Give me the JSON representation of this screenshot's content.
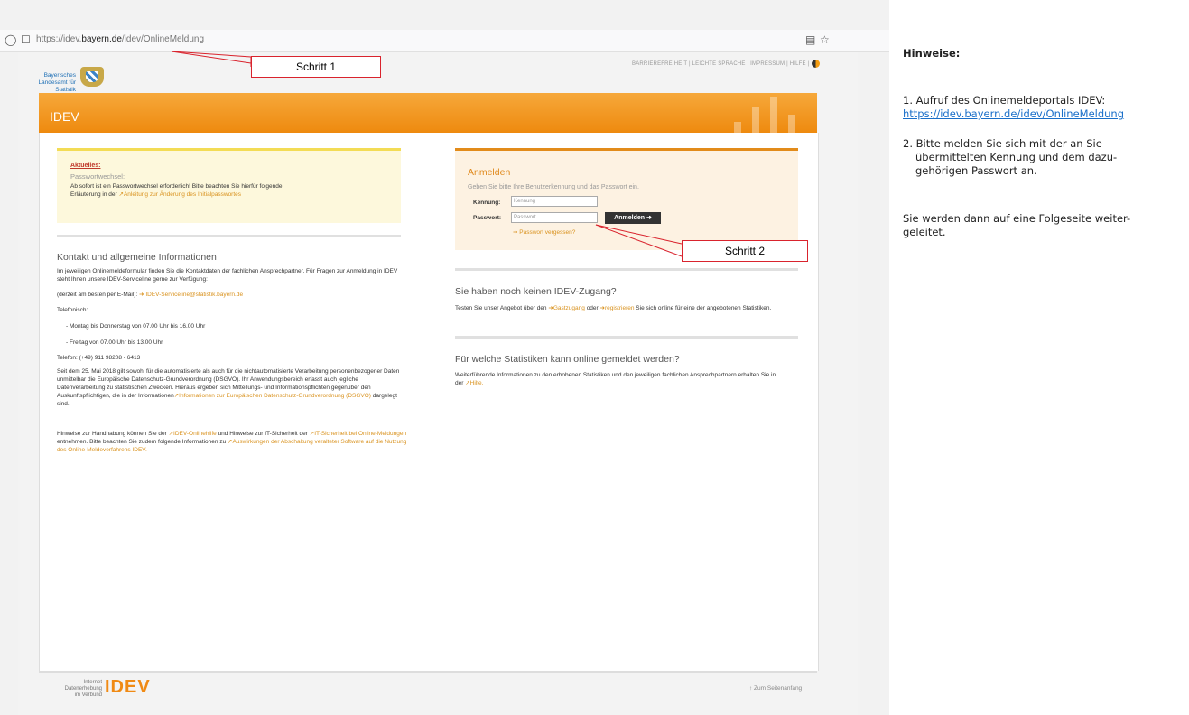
{
  "browser": {
    "url_prefix": "https://idev.",
    "url_host": "bayern.de",
    "url_path": "/idev/OnlineMeldung"
  },
  "site": {
    "logo_line1": "Bayerisches Landesamt für",
    "logo_line2": "Statistik",
    "toplinks": "BARRIEREFREIHEIT | LEICHTE SPRACHE | IMPRESSUM | HILFE |",
    "header_title": "IDEV"
  },
  "aktuelles": {
    "title": "Aktuelles:",
    "subtitle": "Passwortwechsel:",
    "text": "Ab sofort ist ein Passwortwechsel erforderlich! Bitte beachten Sie hierfür folgende",
    "text2": "Erläuterung in der",
    "link": "Anleitung zur Änderung des Initialpasswortes"
  },
  "kontakt": {
    "title": "Kontakt und allgemeine Informationen",
    "p1": "Im jeweiligen Onlinemeldeformular finden Sie die Kontaktdaten der fachlichen Ansprechpartner. Für Fragen zur Anmeldung in IDEV steht Ihnen unsere IDEV-Serviceline gerne zur Verfügung:",
    "email_prefix": "(derzeit am besten per E-Mail):",
    "email": "IDEV-Serviceline@statistik.bayern.de",
    "tel_label": "Telefonisch:",
    "hours1": "- Montag bis Donnerstag von 07.00 Uhr bis 16.00 Uhr",
    "hours2": "- Freitag von 07.00 Uhr bis 13.00 Uhr",
    "phone": "Telefon:  (+49) 911 98208 - 6413",
    "p2": "Seit dem 25. Mai 2018 gilt sowohl für die automatisierte als auch für die nichtautomatisierte Verarbeitung personenbezogener Daten unmittelbar die Europäische Datenschutz-Grundverordnung (DSGVO). Ihr Anwendungsbereich erfasst auch jegliche Datenverarbeitung zu statistischen Zwecken. Hieraus ergeben sich Mitteilungs- und Informationspflichten gegenüber den Auskunftspflichtigen, die in der Informationen",
    "p2_link": "Informationen zur Europäischen Datenschutz-Grundverordnung (DSGVO)",
    "p2_end": "dargelegt sind.",
    "p3a": "Hinweise zur Handhabung können Sie der",
    "p3_link1": "IDEV-Onlinehilfe",
    "p3b": "und Hinweise zur IT-Sicherheit der",
    "p3_link2": "IT-Sicherheit bei Online-Meldungen",
    "p3c": "entnehmen. Bitte beachten Sie zudem folgende Informationen zu",
    "p3_link3": "Auswirkungen der Abschaltung veralteter Software auf die Nutzung des Online-Meldeverfahrens IDEV."
  },
  "login": {
    "title": "Anmelden",
    "hint": "Geben Sie bitte Ihre Benutzerkennung und das Passwort ein.",
    "user_label": "Kennung:",
    "user_placeholder": "Kennung",
    "pass_label": "Passwort:",
    "pass_placeholder": "Passwort",
    "button": "Anmelden ➜",
    "forgot": "Passwort vergessen?"
  },
  "zugang": {
    "title": "Sie haben noch keinen IDEV-Zugang?",
    "t1": "Testen Sie unser Angebot über den",
    "link1": "Gastzugang",
    "t2": "oder",
    "link2": "registrieren",
    "t3": "Sie sich online für eine der angebotenen Statistiken."
  },
  "statistiken": {
    "title": "Für welche Statistiken kann online gemeldet werden?",
    "t1": "Weiterführende Informationen zu den erhobenen Statistiken und den jeweiligen fachlichen Ansprechpartnern erhalten Sie in der",
    "link": "Hilfe."
  },
  "footer": {
    "left1": "Internet Datenerhebung",
    "left2": "im Verbund",
    "brand": "IDEV",
    "right": "↑ Zum Seitenanfang"
  },
  "callouts": {
    "step1": "Schritt 1",
    "step2": "Schritt 2"
  },
  "notes": {
    "title": "Hinweise:",
    "n1": "1. Aufruf des Onlinemeldeportals IDEV:",
    "n1_link": "https://idev.bayern.de/idev/OnlineMeldung",
    "n2a": "2. Bitte melden Sie sich mit der an Sie",
    "n2b": "übermittelten Kennung und dem dazu-",
    "n2c": "gehörigen Passwort an.",
    "n3a": "Sie werden dann auf eine Folgeseite weiter-",
    "n3b": "geleitet."
  },
  "icons": [
    "shield-icon",
    "lock-icon",
    "reader-icon",
    "star-icon",
    "theme-toggle-icon"
  ]
}
